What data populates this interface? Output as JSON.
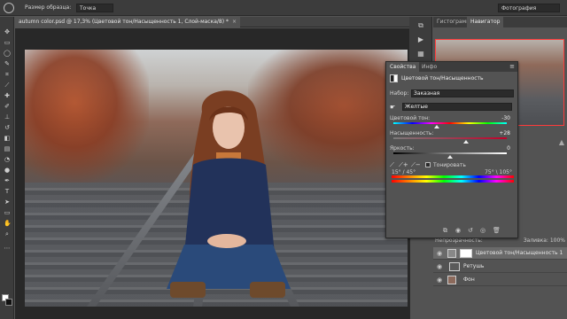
{
  "options_bar": {
    "sample_size_label": "Размер образца:",
    "sample_size_value": "Точка",
    "workspace_value": "Фотография"
  },
  "document_tab": {
    "label": "autumn color.psd @ 17,3% (Цветовой тон/Насыщенность 1, Слой-маска/8) *",
    "close": "×"
  },
  "navigator_tabs": {
    "histogram": "Гистограмма",
    "navigator": "Навигатор"
  },
  "properties": {
    "tabs": [
      "Свойства",
      "Инфо"
    ],
    "menu": "≡",
    "layer_title": "Цветовой тон/Насыщенность",
    "preset_label": "Набор:",
    "preset_value": "Заказная",
    "channel_value": "Желтые",
    "hue_label": "Цветовой тон:",
    "hue_value": "-30",
    "hue_fraction": 0.38,
    "saturation_label": "Насыщенность:",
    "saturation_value": "+28",
    "saturation_fraction": 0.64,
    "lightness_label": "Яркость:",
    "lightness_value": "0",
    "lightness_fraction": 0.5,
    "tonirovanie_label": "Тонировать",
    "deg_left": "15° / 45°",
    "deg_right": "75° \\ 105°"
  },
  "layers_header": {
    "left": "Непрозрачность:",
    "right": "Заливка: 100%"
  },
  "layers": [
    {
      "name": "Цветовой тон/Насыщенность 1",
      "selected": true
    },
    {
      "name": "Ретушь",
      "selected": false
    },
    {
      "name": "Фон",
      "selected": false
    }
  ],
  "colors": {
    "panel_bg": "#535353",
    "dark_bg": "#3c3c3c",
    "accent_frame": "#ff3b3b"
  },
  "icons": [
    "move-tool-icon",
    "marquee-tool-icon",
    "lasso-tool-icon",
    "crop-tool-icon",
    "eyedropper-tool-icon",
    "brush-tool-icon",
    "eraser-tool-icon",
    "text-tool-icon",
    "hand-tool-icon",
    "zoom-tool-icon"
  ]
}
